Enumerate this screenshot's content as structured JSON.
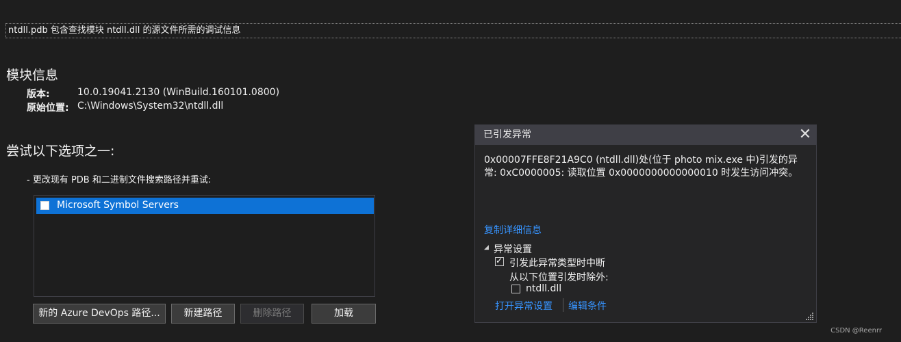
{
  "banner": {
    "text": "ntdll.pdb 包含查找模块 ntdll.dll 的源文件所需的调试信息"
  },
  "module_info": {
    "heading": "模块信息",
    "version_label": "版本:",
    "version_value": "10.0.19041.2130 (WinBuild.160101.0800)",
    "location_label": "原始位置:",
    "location_value": "C:\\Windows\\System32\\ntdll.dll"
  },
  "options": {
    "heading": "尝试以下选项之一:",
    "item_text": "-  更改现有 PDB 和二进制文件搜索路径并重试:",
    "paths": [
      {
        "label": "Microsoft Symbol Servers",
        "checked": false,
        "selected": true
      }
    ],
    "buttons": {
      "azure": "新的 Azure DevOps 路径...",
      "new_path": "新建路径",
      "delete_path": "删除路径",
      "load": "加载"
    }
  },
  "exception": {
    "title": "已引发异常",
    "message": "0x00007FFE8F21A9C0 (ntdll.dll)处(位于 photo mix.exe 中)引发的异常: 0xC0000005: 读取位置 0x0000000000000010 时发生访问冲突。",
    "copy_details": "复制详细信息",
    "settings_header": "异常设置",
    "break_label": "引发此异常类型时中断",
    "break_checked": true,
    "except_label": "从以下位置引发时除外:",
    "except_item": "ntdll.dll",
    "except_item_checked": false,
    "open_settings": "打开异常设置",
    "edit_conditions": "编辑条件"
  },
  "watermark": "CSDN @Reenrr",
  "colors": {
    "accent": "#0e72d6",
    "link": "#3794ff",
    "background": "#1e1e1e"
  }
}
